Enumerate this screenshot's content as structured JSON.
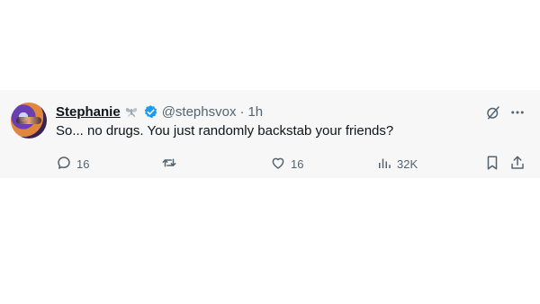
{
  "tweet": {
    "name": "Stephanie",
    "emoji_icon": "butterfly-emoji-icon",
    "verified_icon": "verified-badge-icon",
    "handle": "@stephsvox",
    "separator": "·",
    "time": "1h",
    "text": "So... no drugs. You just randomly backstab your friends?"
  },
  "actions": {
    "reply_count": "16",
    "repost_count": "",
    "like_count": "16",
    "views_count": "32K"
  },
  "icons": {
    "reply": "reply-icon",
    "repost": "repost-icon",
    "like": "heart-icon",
    "views": "views-icon",
    "bookmark": "bookmark-icon",
    "share": "share-icon",
    "grok": "grok-icon",
    "more": "more-icon"
  },
  "colors": {
    "verified": "#1d9bf0",
    "muted": "#536471",
    "text": "#0f1419",
    "background": "#f7f7f7"
  }
}
